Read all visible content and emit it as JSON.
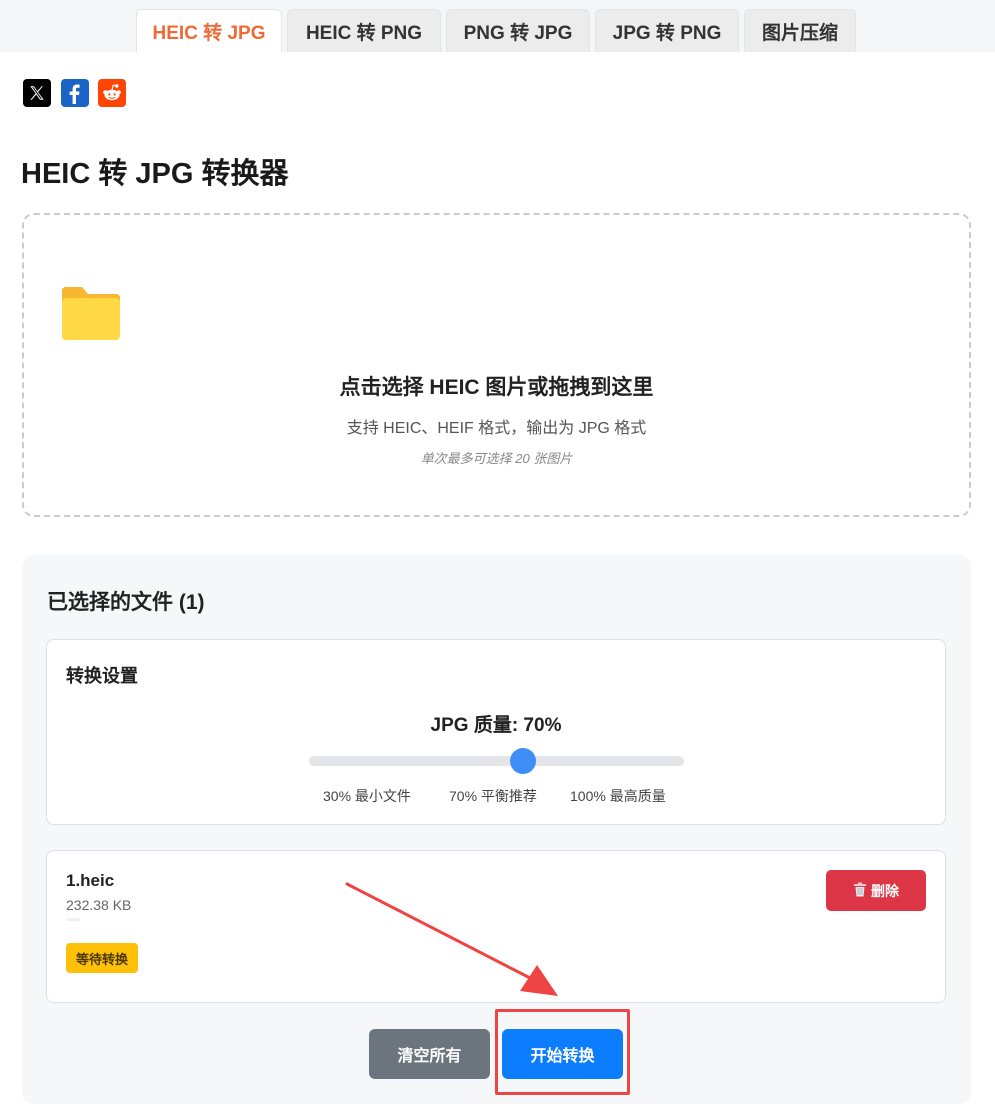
{
  "tabs": [
    {
      "label": "HEIC 转 JPG",
      "active": true
    },
    {
      "label": "HEIC 转 PNG",
      "active": false
    },
    {
      "label": "PNG 转 JPG",
      "active": false
    },
    {
      "label": "JPG 转 PNG",
      "active": false
    },
    {
      "label": "图片压缩",
      "active": false
    }
  ],
  "social": [
    {
      "icon": "x-logo-icon",
      "color": "#000000"
    },
    {
      "icon": "facebook-icon",
      "color": "#1b63c6"
    },
    {
      "icon": "reddit-icon",
      "color": "#ff4500"
    }
  ],
  "page_title": "HEIC 转 JPG 转换器",
  "upload": {
    "icon": "folder-icon",
    "title": "点击选择 HEIC 图片或拖拽到这里",
    "subtitle": "支持 HEIC、HEIF 格式，输出为 JPG 格式",
    "note": "单次最多可选择 20 张图片"
  },
  "selected": {
    "title": "已选择的文件 (1)",
    "settings": {
      "title": "转换设置",
      "quality_label": "JPG 质量: 70%",
      "quality_value": 70,
      "quality_min": 30,
      "quality_max": 100,
      "ticks": [
        "30% 最小文件",
        "70% 平衡推荐",
        "100% 最高质量"
      ]
    },
    "files": [
      {
        "name": "1.heic",
        "size": "232.38 KB",
        "status": "等待转换",
        "delete_label": "删除"
      }
    ]
  },
  "actions": {
    "clear_label": "清空所有",
    "start_label": "开始转换"
  },
  "colors": {
    "accent": "#f06a35",
    "primary": "#0d7dff",
    "danger": "#dc3545",
    "warning": "#ffc107",
    "annotation": "#ef4444"
  }
}
